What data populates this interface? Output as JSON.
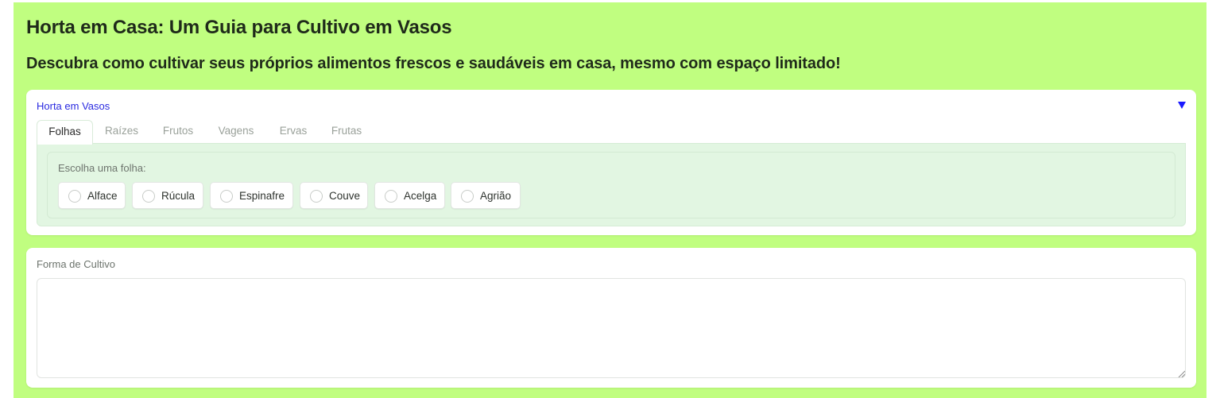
{
  "header": {
    "title": "Horta em Casa: Um Guia para Cultivo em Vasos",
    "subtitle": "Descubra como cultivar seus próprios alimentos frescos e saudáveis em casa, mesmo com espaço limitado!"
  },
  "accordion": {
    "label": "Horta em Vasos",
    "toggle_icon": "triangle-down-icon",
    "expanded": true,
    "tabs": [
      {
        "label": "Folhas",
        "active": true
      },
      {
        "label": "Raízes",
        "active": false
      },
      {
        "label": "Frutos",
        "active": false
      },
      {
        "label": "Vagens",
        "active": false
      },
      {
        "label": "Ervas",
        "active": false
      },
      {
        "label": "Frutas",
        "active": false
      }
    ],
    "radio": {
      "label": "Escolha uma folha:",
      "options": [
        "Alface",
        "Rúcula",
        "Espinafre",
        "Couve",
        "Acelga",
        "Agrião"
      ],
      "selected": null
    }
  },
  "output": {
    "label": "Forma de Cultivo",
    "value": ""
  },
  "colors": {
    "background": "#c0fe80",
    "accordion_label": "#2a2ae0",
    "panel": "#e2f6e2"
  }
}
